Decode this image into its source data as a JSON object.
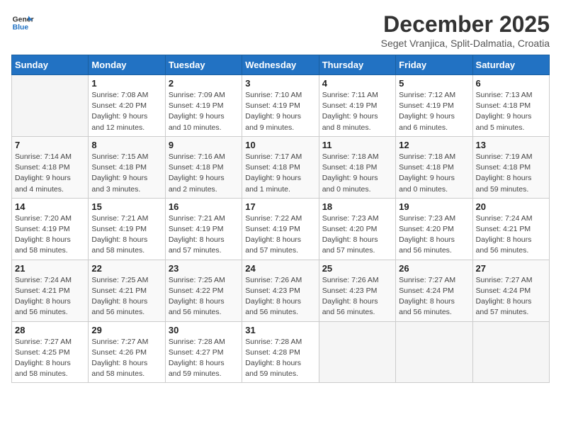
{
  "header": {
    "logo_line1": "General",
    "logo_line2": "Blue",
    "month": "December 2025",
    "location": "Seget Vranjica, Split-Dalmatia, Croatia"
  },
  "weekdays": [
    "Sunday",
    "Monday",
    "Tuesday",
    "Wednesday",
    "Thursday",
    "Friday",
    "Saturday"
  ],
  "weeks": [
    [
      {
        "day": "",
        "info": ""
      },
      {
        "day": "1",
        "info": "Sunrise: 7:08 AM\nSunset: 4:20 PM\nDaylight: 9 hours\nand 12 minutes."
      },
      {
        "day": "2",
        "info": "Sunrise: 7:09 AM\nSunset: 4:19 PM\nDaylight: 9 hours\nand 10 minutes."
      },
      {
        "day": "3",
        "info": "Sunrise: 7:10 AM\nSunset: 4:19 PM\nDaylight: 9 hours\nand 9 minutes."
      },
      {
        "day": "4",
        "info": "Sunrise: 7:11 AM\nSunset: 4:19 PM\nDaylight: 9 hours\nand 8 minutes."
      },
      {
        "day": "5",
        "info": "Sunrise: 7:12 AM\nSunset: 4:19 PM\nDaylight: 9 hours\nand 6 minutes."
      },
      {
        "day": "6",
        "info": "Sunrise: 7:13 AM\nSunset: 4:18 PM\nDaylight: 9 hours\nand 5 minutes."
      }
    ],
    [
      {
        "day": "7",
        "info": "Sunrise: 7:14 AM\nSunset: 4:18 PM\nDaylight: 9 hours\nand 4 minutes."
      },
      {
        "day": "8",
        "info": "Sunrise: 7:15 AM\nSunset: 4:18 PM\nDaylight: 9 hours\nand 3 minutes."
      },
      {
        "day": "9",
        "info": "Sunrise: 7:16 AM\nSunset: 4:18 PM\nDaylight: 9 hours\nand 2 minutes."
      },
      {
        "day": "10",
        "info": "Sunrise: 7:17 AM\nSunset: 4:18 PM\nDaylight: 9 hours\nand 1 minute."
      },
      {
        "day": "11",
        "info": "Sunrise: 7:18 AM\nSunset: 4:18 PM\nDaylight: 9 hours\nand 0 minutes."
      },
      {
        "day": "12",
        "info": "Sunrise: 7:18 AM\nSunset: 4:18 PM\nDaylight: 9 hours\nand 0 minutes."
      },
      {
        "day": "13",
        "info": "Sunrise: 7:19 AM\nSunset: 4:18 PM\nDaylight: 8 hours\nand 59 minutes."
      }
    ],
    [
      {
        "day": "14",
        "info": "Sunrise: 7:20 AM\nSunset: 4:19 PM\nDaylight: 8 hours\nand 58 minutes."
      },
      {
        "day": "15",
        "info": "Sunrise: 7:21 AM\nSunset: 4:19 PM\nDaylight: 8 hours\nand 58 minutes."
      },
      {
        "day": "16",
        "info": "Sunrise: 7:21 AM\nSunset: 4:19 PM\nDaylight: 8 hours\nand 57 minutes."
      },
      {
        "day": "17",
        "info": "Sunrise: 7:22 AM\nSunset: 4:19 PM\nDaylight: 8 hours\nand 57 minutes."
      },
      {
        "day": "18",
        "info": "Sunrise: 7:23 AM\nSunset: 4:20 PM\nDaylight: 8 hours\nand 57 minutes."
      },
      {
        "day": "19",
        "info": "Sunrise: 7:23 AM\nSunset: 4:20 PM\nDaylight: 8 hours\nand 56 minutes."
      },
      {
        "day": "20",
        "info": "Sunrise: 7:24 AM\nSunset: 4:21 PM\nDaylight: 8 hours\nand 56 minutes."
      }
    ],
    [
      {
        "day": "21",
        "info": "Sunrise: 7:24 AM\nSunset: 4:21 PM\nDaylight: 8 hours\nand 56 minutes."
      },
      {
        "day": "22",
        "info": "Sunrise: 7:25 AM\nSunset: 4:21 PM\nDaylight: 8 hours\nand 56 minutes."
      },
      {
        "day": "23",
        "info": "Sunrise: 7:25 AM\nSunset: 4:22 PM\nDaylight: 8 hours\nand 56 minutes."
      },
      {
        "day": "24",
        "info": "Sunrise: 7:26 AM\nSunset: 4:23 PM\nDaylight: 8 hours\nand 56 minutes."
      },
      {
        "day": "25",
        "info": "Sunrise: 7:26 AM\nSunset: 4:23 PM\nDaylight: 8 hours\nand 56 minutes."
      },
      {
        "day": "26",
        "info": "Sunrise: 7:27 AM\nSunset: 4:24 PM\nDaylight: 8 hours\nand 56 minutes."
      },
      {
        "day": "27",
        "info": "Sunrise: 7:27 AM\nSunset: 4:24 PM\nDaylight: 8 hours\nand 57 minutes."
      }
    ],
    [
      {
        "day": "28",
        "info": "Sunrise: 7:27 AM\nSunset: 4:25 PM\nDaylight: 8 hours\nand 58 minutes."
      },
      {
        "day": "29",
        "info": "Sunrise: 7:27 AM\nSunset: 4:26 PM\nDaylight: 8 hours\nand 58 minutes."
      },
      {
        "day": "30",
        "info": "Sunrise: 7:28 AM\nSunset: 4:27 PM\nDaylight: 8 hours\nand 59 minutes."
      },
      {
        "day": "31",
        "info": "Sunrise: 7:28 AM\nSunset: 4:28 PM\nDaylight: 8 hours\nand 59 minutes."
      },
      {
        "day": "",
        "info": ""
      },
      {
        "day": "",
        "info": ""
      },
      {
        "day": "",
        "info": ""
      }
    ]
  ]
}
